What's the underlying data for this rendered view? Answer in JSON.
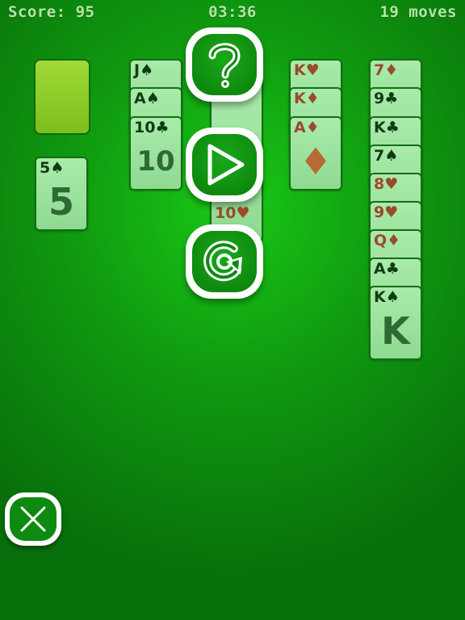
{
  "hud": {
    "score": "Score: 95",
    "time": "03:36",
    "moves": "19 moves"
  },
  "stock": {
    "card": {
      "rank": "5♠",
      "color": "dark",
      "art": "5"
    }
  },
  "columns": {
    "col1": [
      {
        "rank": "J♠",
        "color": "dark"
      },
      {
        "rank": "A♠",
        "color": "dark"
      },
      {
        "rank": "10♣",
        "color": "dark",
        "art": "10"
      }
    ],
    "col2": [
      {
        "rank": "10♥",
        "color": "red"
      }
    ],
    "col3": [
      {
        "rank": "K♥",
        "color": "red"
      },
      {
        "rank": "K♦",
        "color": "red"
      },
      {
        "rank": "A♦",
        "color": "red",
        "art": "♦"
      }
    ],
    "col4": [
      {
        "rank": "7♦",
        "color": "red"
      },
      {
        "rank": "9♣",
        "color": "dark"
      },
      {
        "rank": "K♣",
        "color": "dark"
      },
      {
        "rank": "7♠",
        "color": "dark"
      },
      {
        "rank": "8♥",
        "color": "red"
      },
      {
        "rank": "9♥",
        "color": "red"
      },
      {
        "rank": "Q♦",
        "color": "red"
      },
      {
        "rank": "A♣",
        "color": "dark"
      },
      {
        "rank": "K♠",
        "color": "dark",
        "art": "K"
      }
    ]
  },
  "menu": {
    "help_icon": "question-mark",
    "play_icon": "play-triangle",
    "restart_icon": "circular-arrow",
    "close_icon": "x-mark"
  }
}
